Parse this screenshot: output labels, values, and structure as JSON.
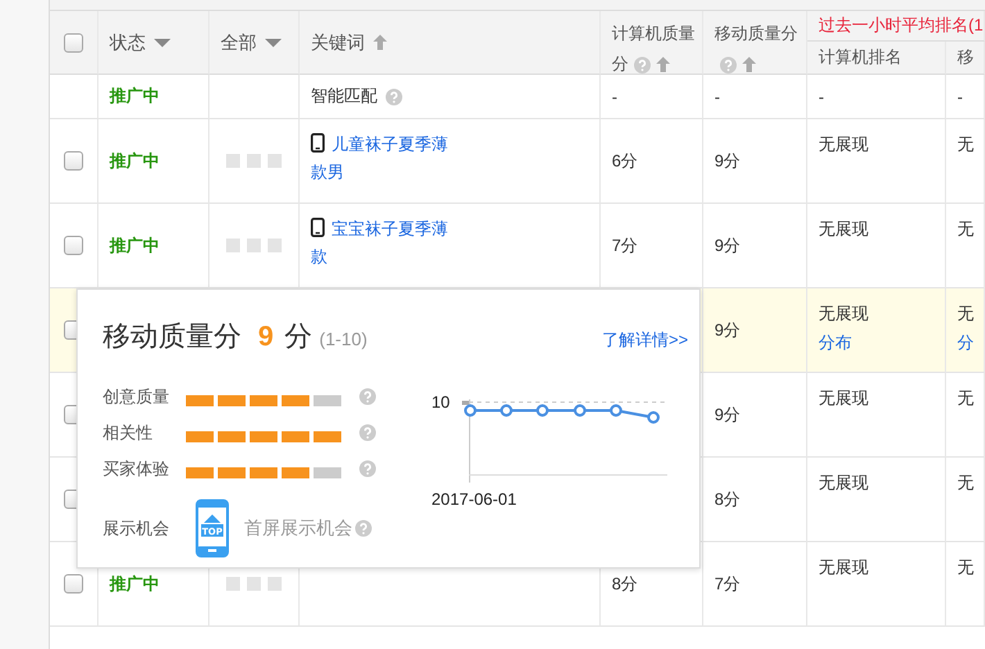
{
  "header": {
    "checked": false,
    "status": "状态",
    "all": "全部",
    "keyword": "关键词",
    "pc_quality_lines": [
      "计算机质量",
      "分"
    ],
    "mobile_quality": "移动质量分",
    "rank_group": "过去一小时平均排名(1",
    "pc_rank": "计算机排名",
    "mobile_rank": "移"
  },
  "rows": [
    {
      "kind": "smart",
      "highlighted": false,
      "status": "推广中",
      "keyword": "智能匹配",
      "pc_quality": "-",
      "mobile_quality": "-",
      "pc_rank": "-",
      "mobile_rank": "-"
    },
    {
      "kind": "keyword",
      "highlighted": false,
      "checked": false,
      "status": "推广中",
      "keyword": "儿童袜子夏季薄款男",
      "pc_quality": "6分",
      "mobile_quality": "9分",
      "pc_rank": "无展现",
      "mobile_rank": "无"
    },
    {
      "kind": "keyword",
      "highlighted": false,
      "checked": false,
      "status": "推广中",
      "keyword": "宝宝袜子夏季薄款",
      "pc_quality": "7分",
      "mobile_quality": "9分",
      "pc_rank": "无展现",
      "mobile_rank": "无"
    },
    {
      "kind": "keyword",
      "highlighted": true,
      "checked": false,
      "mobile_quality": "9分",
      "pc_rank": "无展现",
      "pc_rank_link": "分布",
      "mobile_rank": "无",
      "mobile_rank_link": "分"
    },
    {
      "kind": "keyword",
      "highlighted": false,
      "checked": false,
      "mobile_quality": "9分",
      "pc_rank": "无展现",
      "mobile_rank": "无"
    },
    {
      "kind": "keyword",
      "highlighted": false,
      "checked": false,
      "mobile_quality": "8分",
      "pc_rank": "无展现",
      "mobile_rank": "无"
    },
    {
      "kind": "keyword",
      "highlighted": false,
      "checked": false,
      "status": "推广中",
      "pc_quality": "8分",
      "mobile_quality": "7分",
      "pc_rank": "无展现",
      "mobile_rank": "无"
    }
  ],
  "popup": {
    "title": "移动质量分",
    "score": "9",
    "unit": "分",
    "range": "(1-10)",
    "link": "了解详情>>",
    "metrics": [
      {
        "label": "创意质量",
        "level": 0.8
      },
      {
        "label": "相关性",
        "level": 1
      },
      {
        "label": "买家体验",
        "level": 0.8
      }
    ],
    "display_label": "展示机会",
    "top_badge": "TOP",
    "display_text": "首屏展示机会",
    "chart": {
      "y_tick": "10",
      "x_label": "2017-06-01"
    }
  }
}
